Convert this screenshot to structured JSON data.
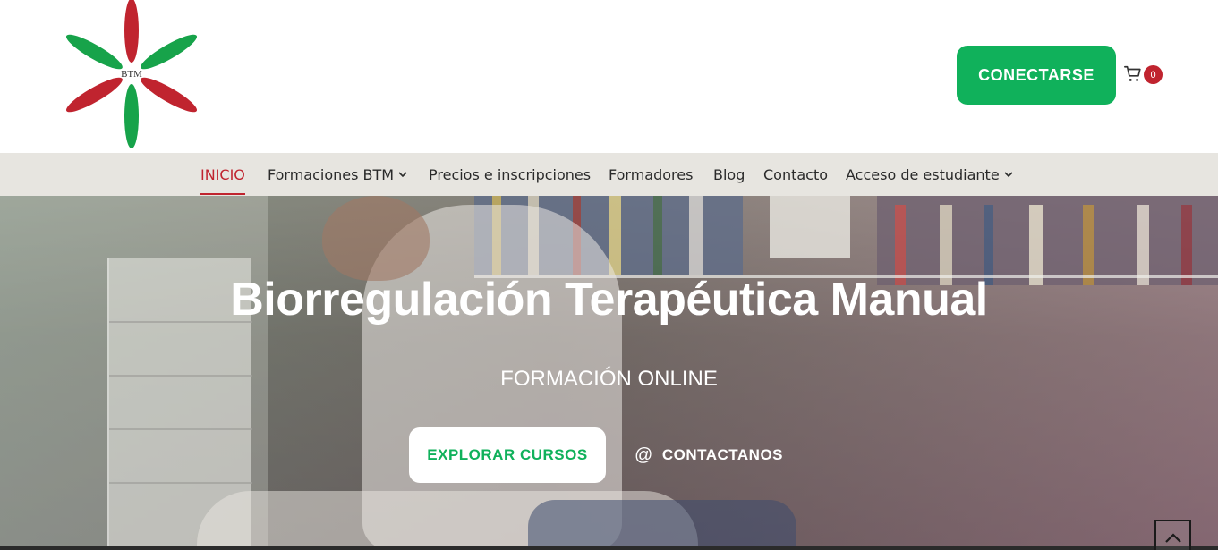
{
  "header": {
    "logo_text": "BTM",
    "login_label": "CONECTARSE",
    "cart_count": "0"
  },
  "nav": {
    "items": [
      {
        "label": "INICIO",
        "active": true
      },
      {
        "label": "Formaciones BTM",
        "dropdown": true
      },
      {
        "label": "Precios e inscripciones"
      },
      {
        "label": "Formadores"
      },
      {
        "label": "Blog"
      },
      {
        "label": "Contacto"
      },
      {
        "label": "Acceso de estudiante",
        "dropdown": true
      }
    ]
  },
  "hero": {
    "title": "Biorregulación Terapéutica Manual",
    "subtitle": "FORMACIÓN ONLINE",
    "explore_label": "EXPLORAR CURSOS",
    "contact_label": "CONTACTANOS"
  },
  "colors": {
    "brand_green": "#10b15b",
    "brand_red": "#c0242f",
    "nav_bg": "#e7e5e0"
  },
  "icons": [
    "cart-icon",
    "chevron-down-icon",
    "at-icon",
    "chevron-up-icon"
  ]
}
